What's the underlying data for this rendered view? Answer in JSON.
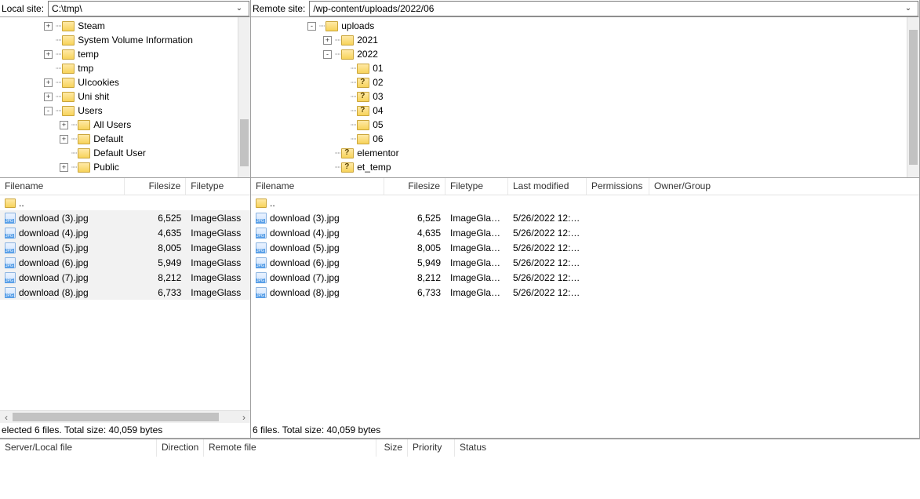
{
  "local": {
    "path_label": "Local site:",
    "path_value": "C:\\tmp\\",
    "tree": [
      {
        "indent": 56,
        "exp": "+",
        "icon": "folder",
        "label": "Steam"
      },
      {
        "indent": 56,
        "exp": "",
        "icon": "folder",
        "label": "System Volume Information"
      },
      {
        "indent": 56,
        "exp": "+",
        "icon": "folder",
        "label": "temp"
      },
      {
        "indent": 56,
        "exp": "",
        "icon": "folder",
        "label": "tmp"
      },
      {
        "indent": 56,
        "exp": "+",
        "icon": "folder",
        "label": "UIcookies"
      },
      {
        "indent": 56,
        "exp": "+",
        "icon": "folder",
        "label": "Uni shit"
      },
      {
        "indent": 56,
        "exp": "-",
        "icon": "folder",
        "label": "Users"
      },
      {
        "indent": 76,
        "exp": "+",
        "icon": "folder",
        "label": "All Users"
      },
      {
        "indent": 76,
        "exp": "+",
        "icon": "folder",
        "label": "Default"
      },
      {
        "indent": 76,
        "exp": "",
        "icon": "folder",
        "label": "Default User"
      },
      {
        "indent": 76,
        "exp": "+",
        "icon": "folder",
        "label": "Public"
      }
    ],
    "columns": {
      "filename": "Filename",
      "filesize": "Filesize",
      "filetype": "Filetype"
    },
    "updir": "..",
    "files": [
      {
        "name": "download (3).jpg",
        "size": "6,525",
        "type": "ImageGlass"
      },
      {
        "name": "download (4).jpg",
        "size": "4,635",
        "type": "ImageGlass"
      },
      {
        "name": "download (5).jpg",
        "size": "8,005",
        "type": "ImageGlass"
      },
      {
        "name": "download (6).jpg",
        "size": "5,949",
        "type": "ImageGlass"
      },
      {
        "name": "download (7).jpg",
        "size": "8,212",
        "type": "ImageGlass"
      },
      {
        "name": "download (8).jpg",
        "size": "6,733",
        "type": "ImageGlass"
      }
    ],
    "status": "elected 6 files. Total size: 40,059 bytes"
  },
  "remote": {
    "path_label": "Remote site:",
    "path_value": "/wp-content/uploads/2022/06",
    "tree": [
      {
        "indent": 72,
        "exp": "-",
        "icon": "folder",
        "label": "uploads"
      },
      {
        "indent": 92,
        "exp": "+",
        "icon": "folder",
        "label": "2021"
      },
      {
        "indent": 92,
        "exp": "-",
        "icon": "folder",
        "label": "2022"
      },
      {
        "indent": 112,
        "exp": "",
        "icon": "folder",
        "label": "01"
      },
      {
        "indent": 112,
        "exp": "",
        "icon": "folder-q",
        "label": "02"
      },
      {
        "indent": 112,
        "exp": "",
        "icon": "folder-q",
        "label": "03"
      },
      {
        "indent": 112,
        "exp": "",
        "icon": "folder-q",
        "label": "04"
      },
      {
        "indent": 112,
        "exp": "",
        "icon": "folder",
        "label": "05"
      },
      {
        "indent": 112,
        "exp": "",
        "icon": "folder",
        "label": "06"
      },
      {
        "indent": 92,
        "exp": "",
        "icon": "folder-q",
        "label": "elementor"
      },
      {
        "indent": 92,
        "exp": "",
        "icon": "folder-q",
        "label": "et_temp"
      }
    ],
    "columns": {
      "filename": "Filename",
      "filesize": "Filesize",
      "filetype": "Filetype",
      "lastmod": "Last modified",
      "perm": "Permissions",
      "owner": "Owner/Group"
    },
    "updir": "..",
    "files": [
      {
        "name": "download (3).jpg",
        "size": "6,525",
        "type": "ImageGlas...",
        "lastmod": "5/26/2022 12:0..."
      },
      {
        "name": "download (4).jpg",
        "size": "4,635",
        "type": "ImageGlas...",
        "lastmod": "5/26/2022 12:0..."
      },
      {
        "name": "download (5).jpg",
        "size": "8,005",
        "type": "ImageGlas...",
        "lastmod": "5/26/2022 12:0..."
      },
      {
        "name": "download (6).jpg",
        "size": "5,949",
        "type": "ImageGlas...",
        "lastmod": "5/26/2022 12:0..."
      },
      {
        "name": "download (7).jpg",
        "size": "8,212",
        "type": "ImageGlas...",
        "lastmod": "5/26/2022 12:0..."
      },
      {
        "name": "download (8).jpg",
        "size": "6,733",
        "type": "ImageGlas...",
        "lastmod": "5/26/2022 12:0..."
      }
    ],
    "status": "6 files. Total size: 40,059 bytes"
  },
  "queue": {
    "cols": {
      "serverlocal": "Server/Local file",
      "direction": "Direction",
      "remotefile": "Remote file",
      "size": "Size",
      "priority": "Priority",
      "status": "Status"
    }
  }
}
